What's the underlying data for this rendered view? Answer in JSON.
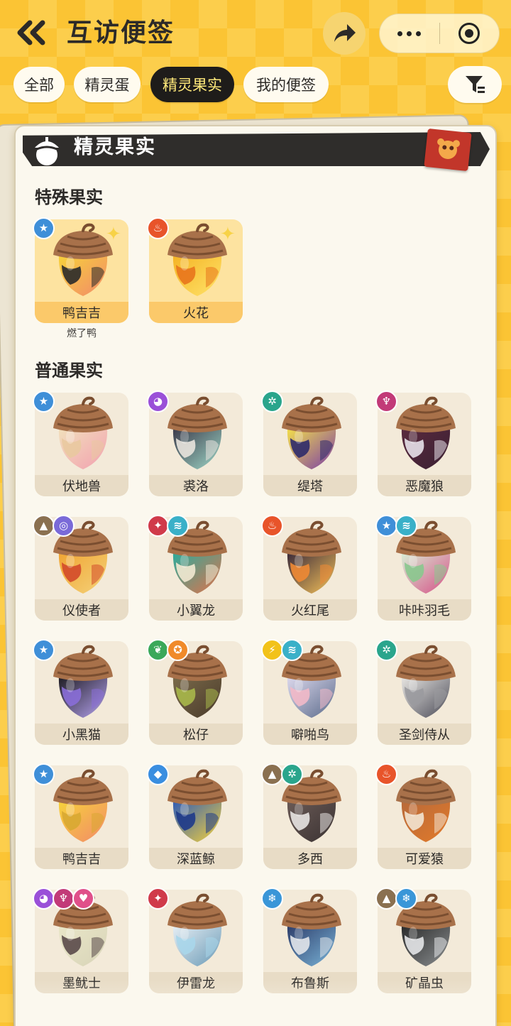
{
  "header": {
    "title": "互访便签"
  },
  "tabs": [
    {
      "label": "全部",
      "active": false
    },
    {
      "label": "精灵蛋",
      "active": false
    },
    {
      "label": "精灵果实",
      "active": true
    },
    {
      "label": "我的便签",
      "active": false
    }
  ],
  "panel": {
    "title": "精灵果实"
  },
  "sections": {
    "special_title": "特殊果实",
    "normal_title": "普通果实"
  },
  "special_fruits": [
    {
      "name": "鸭吉吉",
      "sub": "燃了鸭",
      "badges": [
        "star"
      ],
      "colors": [
        "#f7d23a",
        "#2a2a2a",
        "#f28a6a"
      ]
    },
    {
      "name": "火花",
      "sub": "",
      "badges": [
        "fire"
      ],
      "colors": [
        "#f4b324",
        "#e8741c",
        "#ffe36a"
      ]
    }
  ],
  "normal_fruits": [
    {
      "name": "伏地兽",
      "badges": [
        "star"
      ],
      "colors": [
        "#f1e0bc",
        "#e9c9a0",
        "#f2a0b0"
      ]
    },
    {
      "name": "裘洛",
      "badges": [
        "ghost"
      ],
      "colors": [
        "#3b3a4a",
        "#e9e4de",
        "#9fd8c8"
      ]
    },
    {
      "name": "缇塔",
      "badges": [
        "gear"
      ],
      "colors": [
        "#f3df4a",
        "#2d2a6a",
        "#7a3ba8"
      ]
    },
    {
      "name": "恶魔狼",
      "badges": [
        "demon"
      ],
      "colors": [
        "#5a2a3e",
        "#e8e2ea",
        "#3a2032"
      ]
    },
    {
      "name": "仪使者",
      "badges": [
        "mountain",
        "swirl"
      ],
      "colors": [
        "#f0a533",
        "#d34a2a",
        "#f4d27a"
      ]
    },
    {
      "name": "小翼龙",
      "badges": [
        "dragon",
        "wing"
      ],
      "colors": [
        "#2cab9c",
        "#f2e9d2",
        "#e3714a"
      ]
    },
    {
      "name": "火红尾",
      "badges": [
        "fire"
      ],
      "colors": [
        "#3a2a3a",
        "#f08a34",
        "#f7c35a"
      ]
    },
    {
      "name": "咔咔羽毛",
      "badges": [
        "star",
        "wing"
      ],
      "colors": [
        "#d8efd6",
        "#8ac88e",
        "#d64f86"
      ]
    },
    {
      "name": "小黑猫",
      "badges": [
        "star"
      ],
      "colors": [
        "#1e1c22",
        "#8a6ed8",
        "#b7a4f2"
      ]
    },
    {
      "name": "松仔",
      "badges": [
        "leaf",
        "badge"
      ],
      "colors": [
        "#7a6a4a",
        "#a8b84a",
        "#4a3a2a"
      ]
    },
    {
      "name": "噼啪鸟",
      "badges": [
        "bolt",
        "wing"
      ],
      "colors": [
        "#dcd8ec",
        "#f2b9c8",
        "#5a6a8a"
      ]
    },
    {
      "name": "圣剑侍从",
      "badges": [
        "gear"
      ],
      "colors": [
        "#e8e6e2",
        "#9a9a9e",
        "#4a4a56"
      ]
    },
    {
      "name": "鸭吉吉",
      "badges": [
        "star"
      ],
      "colors": [
        "#f7d23a",
        "#d8a832",
        "#f28a6a"
      ]
    },
    {
      "name": "深蓝鲸",
      "badges": [
        "water"
      ],
      "colors": [
        "#2f5cb6",
        "#1e3a8a",
        "#f7d23a"
      ]
    },
    {
      "name": "多西",
      "badges": [
        "mountain",
        "gear"
      ],
      "colors": [
        "#6a5a56",
        "#e8e4e2",
        "#3a3232"
      ]
    },
    {
      "name": "可爱猿",
      "badges": [
        "fire"
      ],
      "colors": [
        "#b86a3a",
        "#f2e4d2",
        "#e27a2a"
      ]
    },
    {
      "name": "墨鱿士",
      "badges": [
        "ghost",
        "demon",
        "heart"
      ],
      "colors": [
        "#e9e6c8",
        "#5a4a4a",
        "#d8d4b8"
      ]
    },
    {
      "name": "伊雷龙",
      "badges": [
        "dragon"
      ],
      "colors": [
        "#e6eef4",
        "#a8d6ea",
        "#6a9ab6"
      ]
    },
    {
      "name": "布鲁斯",
      "badges": [
        "ice"
      ],
      "colors": [
        "#2d3d6a",
        "#e2e6ea",
        "#7ab4d8"
      ]
    },
    {
      "name": "矿晶虫",
      "badges": [
        "mountain",
        "ice"
      ],
      "colors": [
        "#2a2a2a",
        "#e4e6e8",
        "#8a8e90"
      ]
    }
  ],
  "badge_colors": {
    "star": "#3f8fd8",
    "fire": "#e8542a",
    "ghost": "#9a50d8",
    "gear": "#2aa58c",
    "demon": "#c23a78",
    "mountain": "#8a7050",
    "swirl": "#7a6ad8",
    "dragon": "#d03a4a",
    "wing": "#3ab0c8",
    "leaf": "#3aa85a",
    "badge": "#f08a2a",
    "bolt": "#f2c21a",
    "water": "#3a8ee0",
    "ice": "#3a96d8",
    "heart": "#e0508a"
  },
  "badge_icons": {
    "star": "★",
    "fire": "♨",
    "ghost": "◕",
    "gear": "✲",
    "demon": "♆",
    "mountain": "▲",
    "swirl": "◎",
    "dragon": "✦",
    "wing": "≋",
    "leaf": "❦",
    "badge": "✪",
    "bolt": "⚡",
    "water": "◆",
    "ice": "❄",
    "heart": "♥"
  }
}
